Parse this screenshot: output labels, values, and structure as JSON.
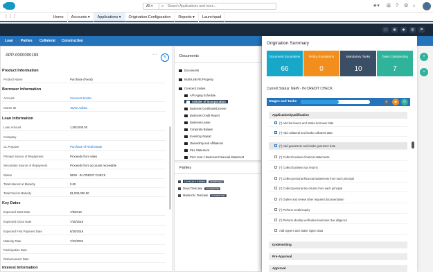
{
  "search": {
    "scope": "All",
    "placeholder": "Search Applications and more..."
  },
  "nav": {
    "app_glyph": "⋮⋮⋮",
    "items": [
      {
        "label": "Home"
      },
      {
        "label": "Accounts ▾"
      },
      {
        "label": "Applications ▾"
      },
      {
        "label": "Origination Configuration"
      },
      {
        "label": "Reports ▾"
      },
      {
        "label": "Launchpad"
      }
    ]
  },
  "tabs": [
    "Loan",
    "Parties",
    "Collateral",
    "Construction"
  ],
  "left": {
    "app_number": "APP-0000000193",
    "product": {
      "heading": "Product Information",
      "rows": [
        {
          "label": "Product Name",
          "value": "Purchase (Fixed)"
        }
      ]
    },
    "borrower": {
      "heading": "Borrower Information",
      "rows": [
        {
          "label": "Account",
          "value": "Crescent Smiles"
        },
        {
          "label": "Owner ID",
          "value": "Taylor Adkins"
        }
      ]
    },
    "loan": {
      "heading": "Loan Information",
      "rows": [
        {
          "label": "Loan Amount",
          "value": "1,000,000.00"
        },
        {
          "label": "Company",
          "value": ""
        },
        {
          "label": "CL Purpose",
          "value": "Purchase of Real Estate"
        },
        {
          "label": "Primary Source of Repayment",
          "value": "Proceeds from sales"
        },
        {
          "label": "Secondary Source of Repayment",
          "value": "Proceeds from accounts receivable"
        },
        {
          "label": "Status",
          "value": "NEW - IN CREDIT CHECK"
        },
        {
          "label": "Total Interest at Maturity",
          "value": "0.00"
        },
        {
          "label": "Total Paid at Maturity",
          "value": "$1,000,000.00"
        }
      ]
    },
    "key_dates": {
      "heading": "Key Dates",
      "rows": [
        {
          "label": "Expected Start Date",
          "value": "7/5/2018"
        },
        {
          "label": "Expected Close Date",
          "value": "7/20/2018"
        },
        {
          "label": "Expected First Payment Date",
          "value": "8/25/2018"
        },
        {
          "label": "Maturity Date",
          "value": "7/22/2024"
        },
        {
          "label": "Participation Date",
          "value": ""
        },
        {
          "label": "Disbursement Date",
          "value": ""
        }
      ]
    },
    "interest_heading": "Interest Information"
  },
  "documents": {
    "title": "Documents",
    "items": [
      {
        "label": "Documents"
      },
      {
        "label": "Multi-Link RE Property"
      },
      {
        "label": "Crescent Smiles"
      },
      {
        "label": "A/R Aging Schedule"
      },
      {
        "label": "Articles of Incorporation"
      },
      {
        "label": "Business Certificate/License"
      },
      {
        "label": "Business Credit Report"
      },
      {
        "label": "Business Lease"
      },
      {
        "label": "Corporate Bylaws"
      },
      {
        "label": "Inventory Report"
      },
      {
        "label": "Ownership and Affiliations"
      },
      {
        "label": "P&L Statement"
      },
      {
        "label": "Prior Year 1 Business Financial Statement"
      }
    ]
  },
  "parties": {
    "title": "Parties",
    "items": [
      {
        "name": "Crescent Smiles",
        "tag": "BORROWER"
      },
      {
        "name": "David Testcase",
        "tag": "GUARANTOR"
      },
      {
        "name": "Marisol N. Testcase",
        "tag": "GUARANTOR"
      }
    ]
  },
  "summary": {
    "title": "Origination Summary",
    "cards": [
      {
        "label": "Document Exceptions",
        "value": "66"
      },
      {
        "label": "Policy Exceptions",
        "value": "0"
      },
      {
        "label": "Mandatory Tasks",
        "value": "10"
      },
      {
        "label": "Tasks Outstanding",
        "value": "7"
      }
    ],
    "status": "Current Status: NEW - IN CREDIT CHECK",
    "stages_label": "Stages and Tasks",
    "progress": 0.55,
    "stages": [
      {
        "label": "Application/Qualification"
      },
      {
        "label": "Underwriting"
      },
      {
        "label": "Pre-Approval"
      },
      {
        "label": "Approval"
      }
    ],
    "tasks": [
      {
        "label": "(*) Add borrowers and intake borrower data",
        "done": true
      },
      {
        "label": "(*) Add collateral and intake collateral data",
        "done": true
      },
      {
        "label": "(*) Add guarantors and intake guarantor data",
        "done": true
      },
      {
        "label": "(*) Collect business financial statements",
        "done": false
      },
      {
        "label": "(*) Collect business tax returns",
        "done": false
      },
      {
        "label": "(*) Collect personal financial statements from each principal",
        "done": false
      },
      {
        "label": "(*) Collect personal tax returns from each principal",
        "done": false
      },
      {
        "label": "(*) Gather and review other required documentation",
        "done": false
      },
      {
        "label": "(*) Perform credit inquiry",
        "done": false
      },
      {
        "label": "(*) Perform identity verification/customer due diligence",
        "done": false
      },
      {
        "label": "Add signers and intake signer data",
        "done": false
      }
    ]
  },
  "colors": {
    "card1": "#17a7c9",
    "card2": "#f28e1c",
    "card3": "#3a4e66",
    "card4": "#2fb39b",
    "brand": "#2573bb"
  }
}
